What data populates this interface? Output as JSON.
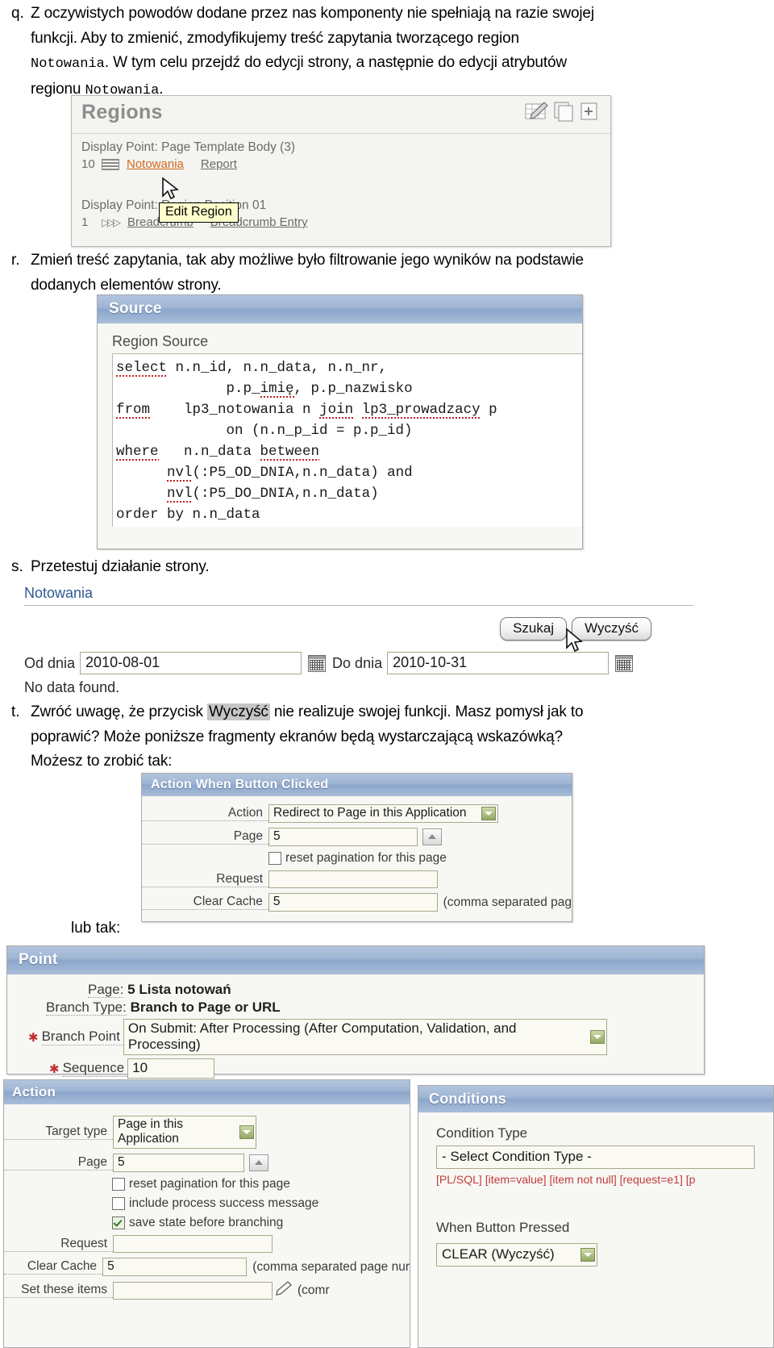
{
  "doc": {
    "items": [
      {
        "marker": "q.",
        "lines": [
          "Z oczywistych powodów dodane przez nas komponenty nie spełniają na razie swojej",
          "funkcji. Aby to zmienić, zmodyfikujemy treść zapytania tworzącego region",
          "Notowania. W tym celu przejdź do edycji strony, a następnie do edycji atrybutów",
          "regionu Notowania."
        ]
      },
      {
        "marker": "r.",
        "lines": [
          "Zmień treść zapytania, tak aby możliwe było filtrowanie jego wyników na podstawie",
          "dodanych elementów strony."
        ]
      },
      {
        "marker": "s.",
        "lines": [
          "Przetestuj działanie strony."
        ]
      },
      {
        "marker": "t.",
        "lines": [
          "Zwróć uwagę, że przycisk Wyczyść nie realizuje swojej funkcji. Masz pomysł jak to",
          "poprawić? Może poniższe fragmenty ekranów będą wystarczającą wskazówką?",
          "Możesz to zrobić tak:"
        ]
      }
    ],
    "lub_tak": "lub tak:"
  },
  "regions": {
    "title": "Regions",
    "display_point_1": "Display Point: Page Template Body (3)",
    "row1": {
      "seq": "10",
      "name": "Notowania",
      "type": "Report"
    },
    "display_point_2": "Display Point: Region Position 01",
    "row2": {
      "seq": "1",
      "name": "Breadcrumb",
      "type": "Breadcrumb Entry"
    },
    "tooltip": "Edit Region",
    "icons": [
      "edit-grid-icon",
      "copy-icon",
      "add-region-icon"
    ]
  },
  "source": {
    "title": "Source",
    "label": "Region Source",
    "sql_lines": [
      {
        "kw": "select",
        "rest": " n.n_id, n.n_data, n.n_nr,"
      },
      {
        "kw": "",
        "rest": "             p.p_imię, p.p_nazwisko"
      },
      {
        "kw": "from",
        "rest": "    lp3_notowania n join lp3_prowadzacy p"
      },
      {
        "kw": "",
        "rest": "             on (n.n_p_id = p.p_id)"
      },
      {
        "kw": "where",
        "rest": "   n.n_data between"
      },
      {
        "kw": "",
        "rest": "      nvl(:P5_OD_DNIA,n.n_data) and"
      },
      {
        "kw": "",
        "rest": "      nvl(:P5_DO_DNIA,n.n_data)"
      },
      {
        "kw": "",
        "rest": "order by n.n_data"
      }
    ]
  },
  "notowania": {
    "title": "Notowania",
    "buttons": {
      "search": "Szukaj",
      "clear": "Wyczyść"
    },
    "from_label": "Od dnia",
    "from_value": "2010-08-01",
    "to_label": "Do dnia",
    "to_value": "2010-10-31",
    "no_data": "No data found."
  },
  "action_when_button_clicked": {
    "title": "Action When Button Clicked",
    "action_label": "Action",
    "action_value": "Redirect to Page in this Application",
    "page_label": "Page",
    "page_value": "5",
    "reset_pagination_label": "reset pagination for this page",
    "reset_pagination_checked": false,
    "request_label": "Request",
    "request_value": "",
    "clear_cache_label": "Clear Cache",
    "clear_cache_value": "5",
    "clear_cache_hint": "(comma separated pag"
  },
  "point": {
    "title": "Point",
    "page_label": "Page:",
    "page_value": "5 Lista notowań",
    "branch_type_label": "Branch Type:",
    "branch_type_value": "Branch to Page or URL",
    "branch_point_label": "Branch Point",
    "branch_point_value": "On Submit: After Processing (After Computation, Validation, and Processing)",
    "sequence_label": "Sequence",
    "sequence_value": "10"
  },
  "action": {
    "title": "Action",
    "target_type_label": "Target type",
    "target_type_value": "Page in this Application",
    "page_label": "Page",
    "page_value": "5",
    "checkboxes": [
      {
        "label": "reset pagination for this page",
        "checked": false
      },
      {
        "label": "include process success message",
        "checked": false
      },
      {
        "label": "save state before branching",
        "checked": true
      }
    ],
    "request_label": "Request",
    "request_value": "",
    "clear_cache_label": "Clear Cache",
    "clear_cache_value": "5",
    "clear_cache_hint": "(comma separated page nur",
    "set_items_label": "Set these items",
    "set_items_value": "",
    "set_items_hint": "(comr"
  },
  "conditions": {
    "title": "Conditions",
    "condition_type_label": "Condition Type",
    "condition_type_value": "- Select Condition Type -",
    "tokens": "[PL/SQL]  [item=value]  [item not null]  [request=e1]  [p",
    "when_button_pressed_label": "When Button Pressed",
    "when_button_pressed_value": "CLEAR (Wyczyść)"
  },
  "colors": {
    "panel_header_blue": "#8ca6cc",
    "link_orange": "#d3681a",
    "link_blue": "#2e5b8f",
    "field_border": "#a8a98c",
    "token_red": "#c13b3b",
    "tooltip_bg": "#ffffcc"
  }
}
